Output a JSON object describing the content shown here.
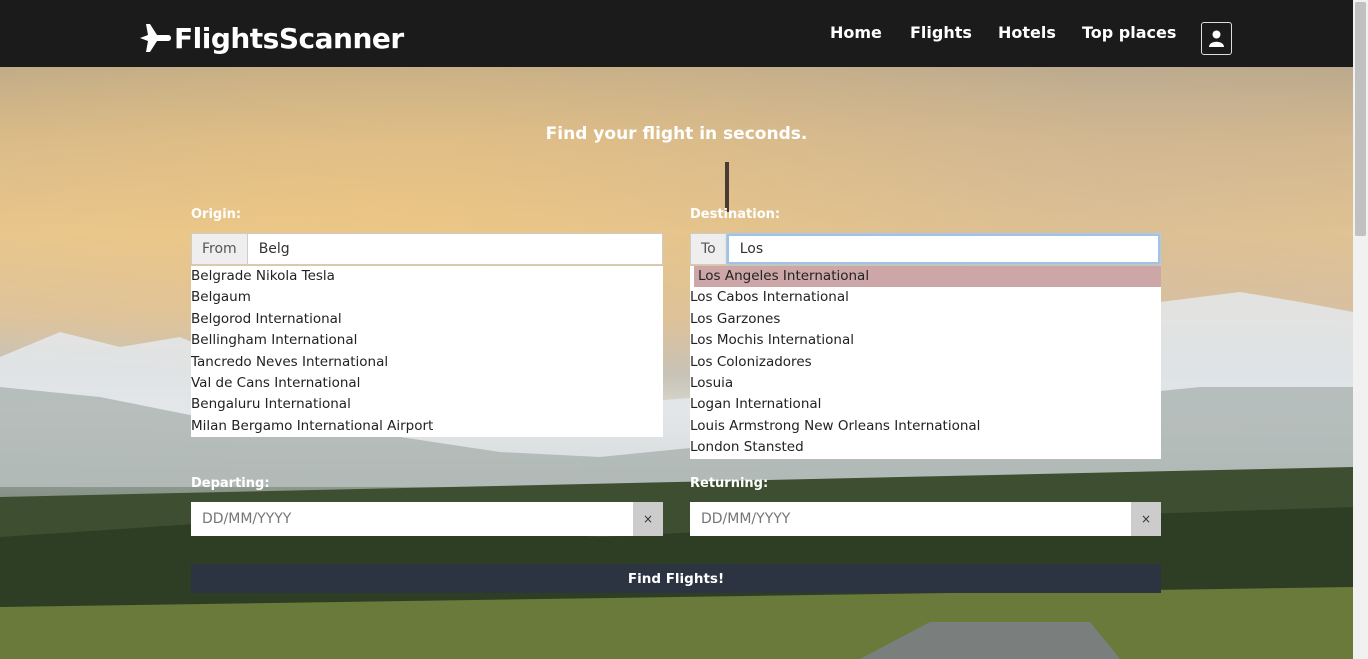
{
  "navbar": {
    "brand": "FlightsScanner",
    "links": [
      "Home",
      "Flights",
      "Hotels",
      "Top places"
    ]
  },
  "hero": {
    "tagline": "Find your flight in seconds."
  },
  "origin": {
    "label": "Origin:",
    "addon": "From",
    "value": "Belg",
    "options": [
      "Belgrade Nikola Tesla",
      "Belgaum",
      "Belgorod International",
      "Bellingham International",
      "Tancredo Neves International",
      "Val de Cans International",
      "Bengaluru International",
      "Milan Bergamo International Airport"
    ]
  },
  "destination": {
    "label": "Destination:",
    "addon": "To",
    "value": "Los",
    "options": [
      "Los Angeles International",
      "Los Cabos International",
      "Los Garzones",
      "Los Mochis International",
      "Los Colonizadores",
      "Losuia",
      "Logan International",
      "Louis Armstrong New Orleans International",
      "London Stansted"
    ]
  },
  "departing": {
    "label": "Departing:",
    "placeholder": "DD/MM/YYYY",
    "clear": "×"
  },
  "returning": {
    "label": "Returning:",
    "placeholder": "DD/MM/YYYY",
    "clear": "×"
  },
  "submit": "Find Flights!"
}
